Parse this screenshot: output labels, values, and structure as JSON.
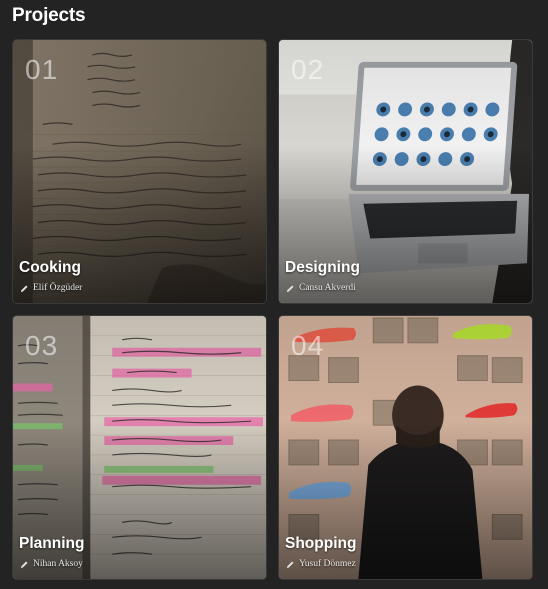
{
  "header": {
    "title": "Projects"
  },
  "projects": [
    {
      "number": "01",
      "title": "Cooking",
      "author": "Elif Özgüder",
      "icon": "pencil-icon"
    },
    {
      "number": "02",
      "title": "Designing",
      "author": "Cansu Akverdi",
      "icon": "pencil-icon"
    },
    {
      "number": "03",
      "title": "Planning",
      "author": "Nihan Aksoy",
      "icon": "pencil-icon"
    },
    {
      "number": "04",
      "title": "Shopping",
      "author": "Yusuf Dönmez",
      "icon": "pencil-icon"
    }
  ]
}
